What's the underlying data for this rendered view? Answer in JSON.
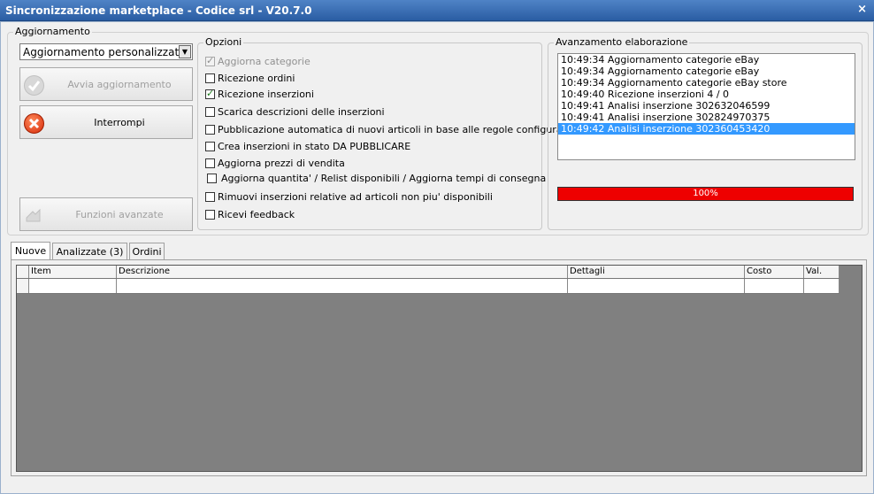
{
  "window": {
    "title": "Sincronizzazione marketplace - Codice srl - V20.7.0",
    "close_glyph": "×"
  },
  "aggiornamento": {
    "label": "Aggiornamento",
    "mode_selected": "Aggiornamento personalizzato",
    "start_button": "Avvia aggiornamento",
    "stop_button": "Interrompi",
    "advanced_button": "Funzioni avanzate",
    "icons": {
      "start": "check-circle-icon",
      "stop": "cancel-circle-icon",
      "advanced": "tools-icon"
    }
  },
  "opzioni": {
    "label": "Opzioni",
    "items": [
      {
        "label": "Aggiorna categorie",
        "checked": true,
        "disabled": true
      },
      {
        "label": "Ricezione ordini",
        "checked": false,
        "disabled": false
      },
      {
        "label": "Ricezione inserzioni",
        "checked": true,
        "disabled": false
      },
      {
        "label": "Scarica descrizioni delle inserzioni",
        "checked": false,
        "disabled": false
      },
      {
        "label": "Pubblicazione automatica di nuovi articoli in base alle regole configurate",
        "checked": false,
        "disabled": false
      },
      {
        "label": "Crea inserzioni in stato DA PUBBLICARE",
        "checked": false,
        "disabled": false
      },
      {
        "label": "Aggiorna prezzi di vendita",
        "checked": false,
        "disabled": false
      },
      {
        "label": "Aggiorna quantita' / Relist disponibili / Aggiorna tempi di consegna",
        "checked": false,
        "disabled": false
      },
      {
        "label": "Rimuovi inserzioni relative ad articoli non piu' disponibili",
        "checked": false,
        "disabled": false
      },
      {
        "label": "Ricevi feedback",
        "checked": false,
        "disabled": false
      }
    ]
  },
  "avanzamento": {
    "label": "Avanzamento elaborazione",
    "log": [
      {
        "text": "10:49:34 Aggiornamento categorie eBay",
        "selected": false
      },
      {
        "text": "10:49:34 Aggiornamento categorie eBay",
        "selected": false
      },
      {
        "text": "10:49:34 Aggiornamento categorie eBay store",
        "selected": false
      },
      {
        "text": "10:49:40 Ricezione inserzioni 4 / 0",
        "selected": false
      },
      {
        "text": "10:49:41 Analisi inserzione 302632046599",
        "selected": false
      },
      {
        "text": "10:49:41 Analisi inserzione 302824970375",
        "selected": false
      },
      {
        "text": "10:49:42 Analisi inserzione 302360453420",
        "selected": true
      }
    ],
    "progress_value": 100,
    "progress_text": "100%",
    "progress_color": "#ee0000",
    "selection_color": "#3399ff"
  },
  "tabs": [
    {
      "label": "Nuove",
      "active": true
    },
    {
      "label": "Analizzate (3)",
      "active": false
    },
    {
      "label": "Ordini",
      "active": false
    }
  ],
  "grid": {
    "columns": [
      "",
      "Item",
      "Descrizione",
      "Dettagli",
      "Costo",
      "Val."
    ]
  }
}
